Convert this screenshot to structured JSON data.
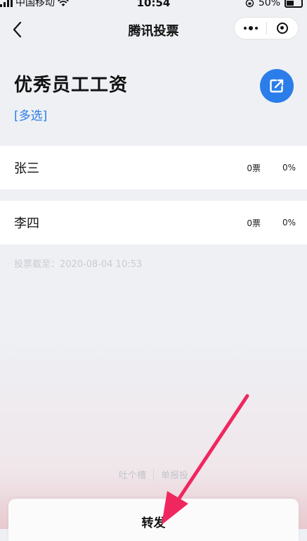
{
  "status_bar": {
    "carrier": "中国移动",
    "time": "10:54",
    "battery_text": "50%",
    "battery_level": 0.5
  },
  "nav": {
    "title": "腾讯投票",
    "back_icon": "chevron-left-icon",
    "more_icon": "more-dots-icon",
    "close_icon": "close-circle-icon"
  },
  "poll": {
    "title": "优秀员工工资",
    "type": "[多选]",
    "share_icon": "share-external-icon",
    "deadline": "投票截至：2020-08-04 10:53"
  },
  "options": [
    {
      "name": "张三",
      "votes": "0票",
      "percent": "0%"
    },
    {
      "name": "李四",
      "votes": "0票",
      "percent": "0%"
    }
  ],
  "footer": {
    "complain": "吐个槽",
    "report": "单报投",
    "share_sheet_label": "转发"
  },
  "colors": {
    "accent": "#2b7de9",
    "annotation_arrow": "#f0275f"
  }
}
